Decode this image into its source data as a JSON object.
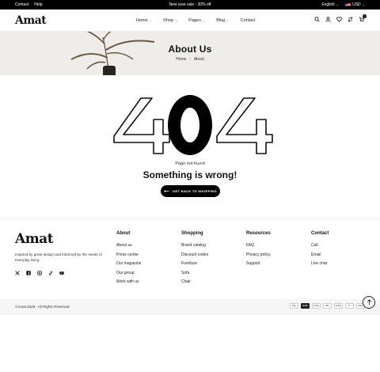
{
  "topbar": {
    "links": [
      "Contact",
      "Help"
    ],
    "announcement": "New year sale - 30% off",
    "language": "English",
    "currency": "USD"
  },
  "header": {
    "logo": "Amat",
    "nav": [
      "Home",
      "Shop",
      "Pages",
      "Blog",
      "Contact"
    ],
    "cart_count": "0",
    "icons": [
      "search-icon",
      "user-icon",
      "heart-icon",
      "compare-icon",
      "cart-icon"
    ]
  },
  "banner": {
    "title": "About Us",
    "breadcrumb": [
      "Home",
      "About"
    ]
  },
  "error": {
    "code": "404",
    "small": "Page not found",
    "big": "Something is wrong!",
    "button": "GET BACK TO SHOPPING"
  },
  "footer": {
    "logo": "Amat",
    "description": "Inspired by great design and informed by the needs of everyday living.",
    "social": [
      "x-icon",
      "facebook-icon",
      "instagram-icon",
      "tiktok-icon",
      "youtube-icon"
    ],
    "columns": [
      {
        "title": "About",
        "links": [
          "About us",
          "Press center",
          "Our magazine",
          "Our group",
          "Work with us"
        ]
      },
      {
        "title": "Shopping",
        "links": [
          "Brand catalog",
          "Discount codes",
          "Furniture",
          "Sofa",
          "Chair"
        ]
      },
      {
        "title": "Resources",
        "links": [
          "FAQ",
          "Privacy policy",
          "Support"
        ]
      },
      {
        "title": "Contact",
        "links": [
          "Call",
          "Email",
          "Live chat"
        ]
      }
    ],
    "copyright": "©Amat 2025 - All Rights Reserved.",
    "payments": [
      "Pay",
      "AMEX",
      "G Pay",
      "MC",
      "G Pay",
      "P",
      "VISA"
    ]
  },
  "colors": {
    "dark": "#000000",
    "banner_bg": "#efedea",
    "bottom_bg": "#f6f6f6"
  }
}
